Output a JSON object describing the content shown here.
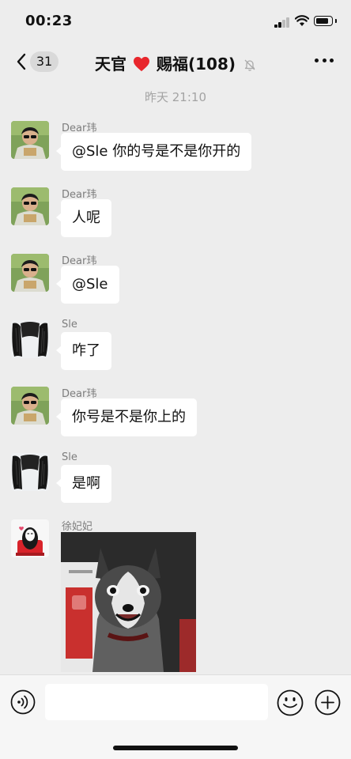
{
  "status_bar": {
    "time": "00:23"
  },
  "header": {
    "back_count": "31",
    "title_pre": "天官",
    "title_post": "赐福(108)"
  },
  "chat": {
    "timestamp": "昨天 21:10",
    "messages": [
      {
        "sender": "Dear玮",
        "text": "@Sle 你的号是不是你开的"
      },
      {
        "sender": "Dear玮",
        "text": "人呢"
      },
      {
        "sender": "Dear玮",
        "text": "@Sle"
      },
      {
        "sender": "Sle",
        "text": "咋了"
      },
      {
        "sender": "Dear玮",
        "text": "你号是不是你上的"
      },
      {
        "sender": "Sle",
        "text": "是啊"
      },
      {
        "sender": "徐妃妃",
        "image": "husky-dog-photo"
      }
    ]
  },
  "input": {
    "placeholder": ""
  },
  "colors": {
    "bubble": "#ffffff",
    "background": "#ededed",
    "heart": "#e8262c"
  }
}
